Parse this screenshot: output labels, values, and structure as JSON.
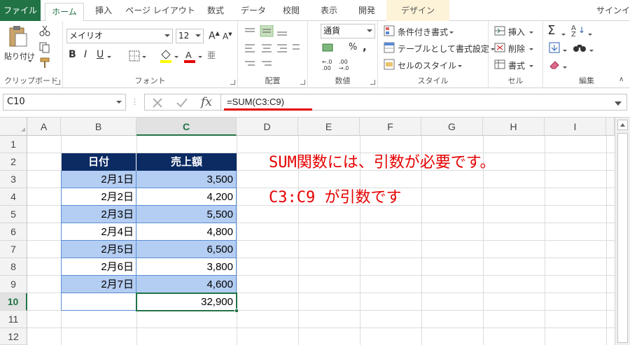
{
  "tabs": [
    {
      "label": "ファイル",
      "kind": "file"
    },
    {
      "label": "ホーム",
      "kind": "active"
    },
    {
      "label": "挿入",
      "kind": "normal"
    },
    {
      "label": "ページ レイアウト",
      "kind": "normal"
    },
    {
      "label": "数式",
      "kind": "normal"
    },
    {
      "label": "データ",
      "kind": "normal"
    },
    {
      "label": "校閲",
      "kind": "normal"
    },
    {
      "label": "表示",
      "kind": "normal"
    },
    {
      "label": "開発",
      "kind": "normal"
    },
    {
      "label": "デザイン",
      "kind": "design"
    }
  ],
  "signin": "サインイン",
  "ribbon": {
    "clipboard": {
      "paste": "貼り付け",
      "label": "クリップボード"
    },
    "font": {
      "name": "メイリオ",
      "size": "12",
      "label": "フォント"
    },
    "alignment": {
      "label": "配置"
    },
    "number": {
      "format": "通貨",
      "label": "数値"
    },
    "styles": {
      "conditional": "条件付き書式",
      "table": "テーブルとして書式設定",
      "cell_style": "セルのスタイル",
      "label": "スタイル"
    },
    "cells": {
      "insert": "挿入",
      "delete": "削除",
      "format": "書式",
      "label": "セル"
    },
    "editing": {
      "label": "編集"
    }
  },
  "formula_bar": {
    "name_box": "C10",
    "formula": "=SUM(C3:C9)"
  },
  "columns": [
    "A",
    "B",
    "C",
    "D",
    "E",
    "F",
    "G",
    "H",
    "I"
  ],
  "selected_column": "C",
  "rows": [
    "1",
    "2",
    "3",
    "4",
    "5",
    "6",
    "7",
    "8",
    "9",
    "10",
    "11",
    "12"
  ],
  "selected_row": "10",
  "table": {
    "headers": [
      "日付",
      "売上額"
    ],
    "data": [
      {
        "date": "2月1日",
        "amount": "3,500"
      },
      {
        "date": "2月2日",
        "amount": "4,200"
      },
      {
        "date": "2月3日",
        "amount": "5,500"
      },
      {
        "date": "2月4日",
        "amount": "4,800"
      },
      {
        "date": "2月5日",
        "amount": "6,500"
      },
      {
        "date": "2月6日",
        "amount": "3,800"
      },
      {
        "date": "2月7日",
        "amount": "4,600"
      }
    ],
    "total": "32,900"
  },
  "annotations": [
    "SUM関数には、引数が必要です。",
    "C3:C9 が引数です"
  ],
  "colors": {
    "accent": "#217346",
    "header_fill": "#0c2b63",
    "band_fill": "#b4cdf2",
    "annotation": "#e60000"
  }
}
